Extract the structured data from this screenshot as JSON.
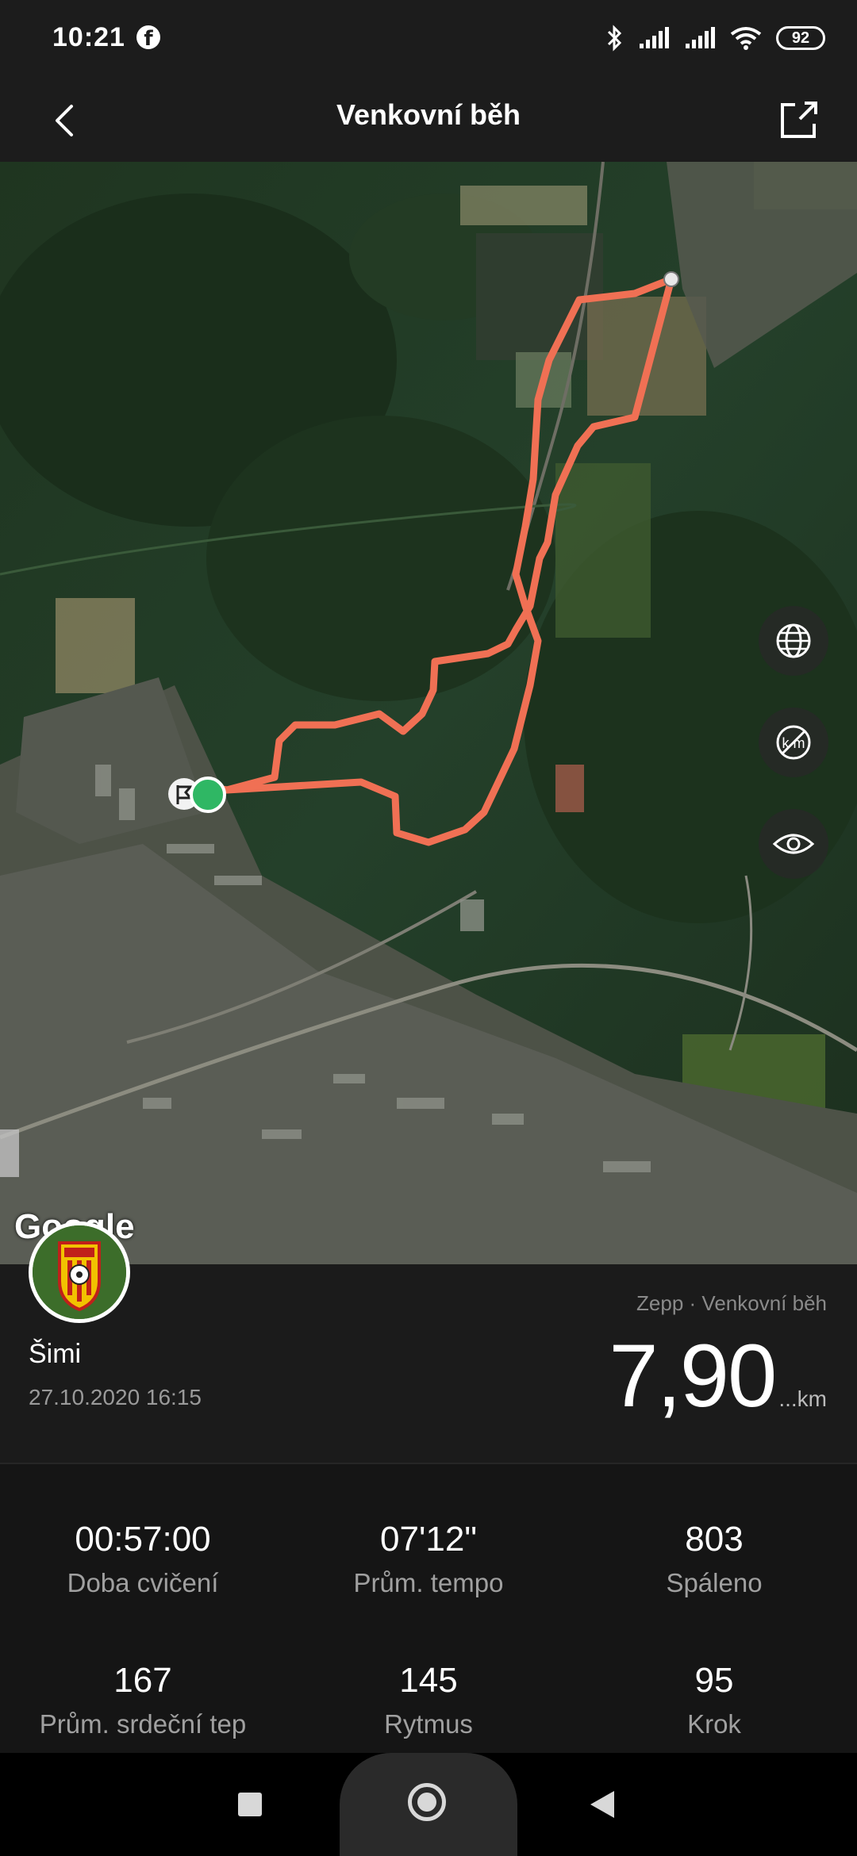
{
  "status_bar": {
    "time": "10:21",
    "battery": "92"
  },
  "header": {
    "title": "Venkovní běh"
  },
  "map": {
    "attribution": "Google",
    "route_color": "#F07054",
    "buttons": [
      "globe-icon",
      "km-toggle-icon",
      "eye-icon"
    ]
  },
  "summary": {
    "user_name": "Šimi",
    "date": "27.10.2020 16:15",
    "source": "Zepp · Venkovní běh",
    "distance": "7,90",
    "distance_unit": "...km"
  },
  "stats": [
    {
      "value": "00:57:00",
      "label": "Doba cvičení"
    },
    {
      "value": "07'12\"",
      "label": "Prům. tempo"
    },
    {
      "value": "803",
      "label": "Spáleno"
    },
    {
      "value": "167",
      "label": "Prům. srdeční tep"
    },
    {
      "value": "145",
      "label": "Rytmus"
    },
    {
      "value": "95",
      "label": "Krok"
    }
  ]
}
